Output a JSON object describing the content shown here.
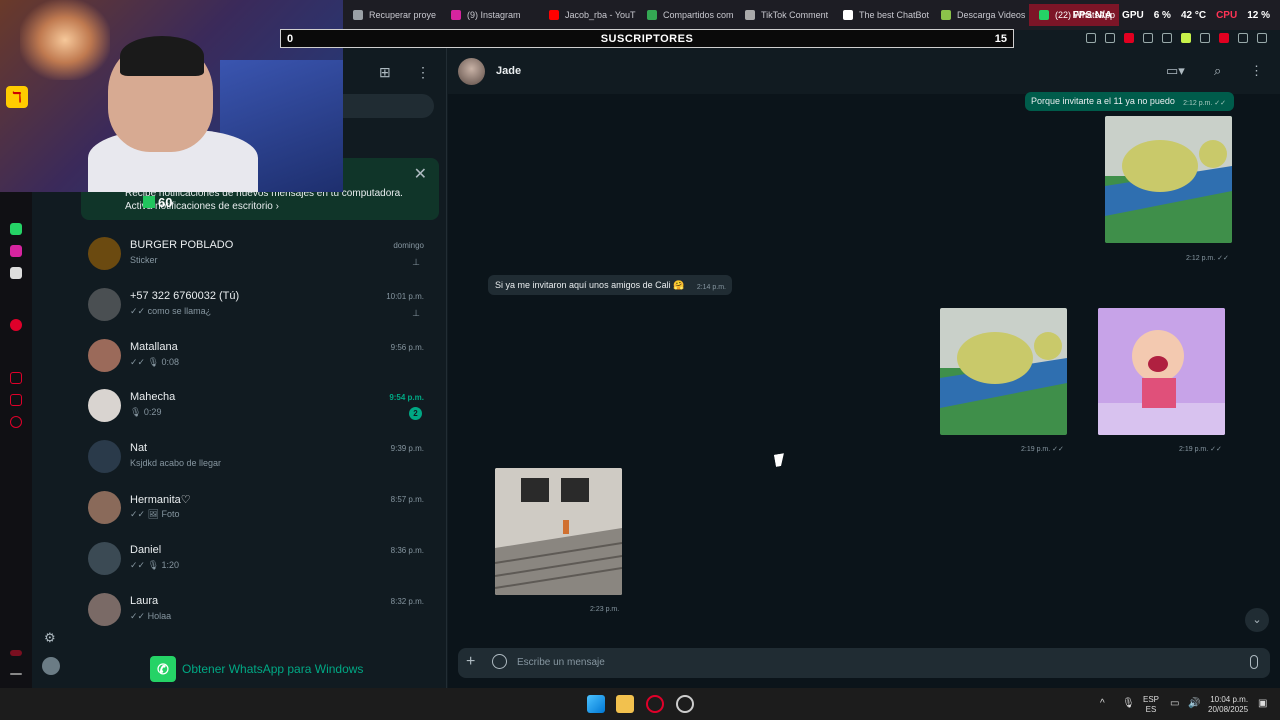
{
  "browser": {
    "tabs": [
      {
        "label": "Recuperar proye",
        "color": "#9aa0a6"
      },
      {
        "label": "(9) Instagram",
        "color": "#d6249f"
      },
      {
        "label": "Jacob_rba - YouT",
        "color": "#ff0000"
      },
      {
        "label": "Compartidos com",
        "color": "#34a853"
      },
      {
        "label": "TikTok Comment",
        "color": "#aaaaaa"
      },
      {
        "label": "The best ChatBot",
        "color": "#ffffff"
      },
      {
        "label": "Descarga Videos",
        "color": "#8bc34a"
      },
      {
        "label": "(22) WhatsApp",
        "color": "#25d366"
      }
    ],
    "hw": {
      "fps": "FPS N/A",
      "gpu_label": "GPU",
      "gpu_val": "6 %",
      "gpu_temp": "42 °C",
      "cpu_label": "CPU",
      "cpu_val": "12 %"
    }
  },
  "subscriber_bar": {
    "left": "0",
    "title": "SUSCRIPTORES",
    "right": "15"
  },
  "webcam_overlay": {
    "badge": "60"
  },
  "whatsapp": {
    "notification": {
      "line1": "Recibe notificaciones de nuevos mensajes en tu computadora.",
      "line2": "Activa notificaciones de escritorio ›"
    },
    "chats": [
      {
        "name": "BURGER POBLADO",
        "preview": "Sticker",
        "time": "domingo",
        "pinned": true,
        "unread": "",
        "avatar": "#6b4a10"
      },
      {
        "name": "+57 322 6760032 (Tú)",
        "preview": "✓✓ como se llama¿",
        "time": "10:01 p.m.",
        "pinned": true,
        "unread": "",
        "avatar": "#4a4f52"
      },
      {
        "name": "Matallana",
        "preview": "✓✓ 🎙 0:08",
        "time": "9:56 p.m.",
        "pinned": false,
        "unread": "",
        "avatar": "#9b6a5a"
      },
      {
        "name": "Mahecha",
        "preview": "🎙 0:29",
        "time": "9:54 p.m.",
        "pinned": false,
        "unread": "2",
        "avatar": "#d9d4d0"
      },
      {
        "name": "Nat",
        "preview": "Ksjdkd acabo de llegar",
        "time": "9:39 p.m.",
        "pinned": false,
        "unread": "",
        "avatar": "#2a3a4a"
      },
      {
        "name": "Hermanita♡",
        "preview": "✓✓ 🖼 Foto",
        "time": "8:57 p.m.",
        "pinned": false,
        "unread": "",
        "avatar": "#8a6a5a"
      },
      {
        "name": "Daniel",
        "preview": "✓✓ 🎙 1:20",
        "time": "8:36 p.m.",
        "pinned": false,
        "unread": "",
        "avatar": "#3b4a54"
      },
      {
        "name": "Laura",
        "preview": "✓✓ Holaa",
        "time": "8:32 p.m.",
        "pinned": false,
        "unread": "",
        "avatar": "#7a6a66"
      }
    ],
    "get_app": "Obtener WhatsApp para Windows",
    "conversation": {
      "contact": "Jade",
      "out_text": {
        "text": "Porque invitarte a el 11 ya no puedo",
        "time": "2:12 p.m. ✓✓"
      },
      "sticker1_time": "2:12 p.m. ✓✓",
      "in_text": {
        "text": "Si ya me invitaron aquí unos amigos de Cali 🤗",
        "time": "2:14 p.m."
      },
      "sticker2_time": "2:19 p.m. ✓✓",
      "sticker3_time": "2:19 p.m. ✓✓",
      "photo_time": "2:23 p.m.",
      "compose_placeholder": "Escribe un mensaje"
    }
  },
  "taskbar": {
    "lang1": "ESP",
    "lang2": "ES",
    "time": "10:04 p.m.",
    "date": "20/08/2025"
  }
}
